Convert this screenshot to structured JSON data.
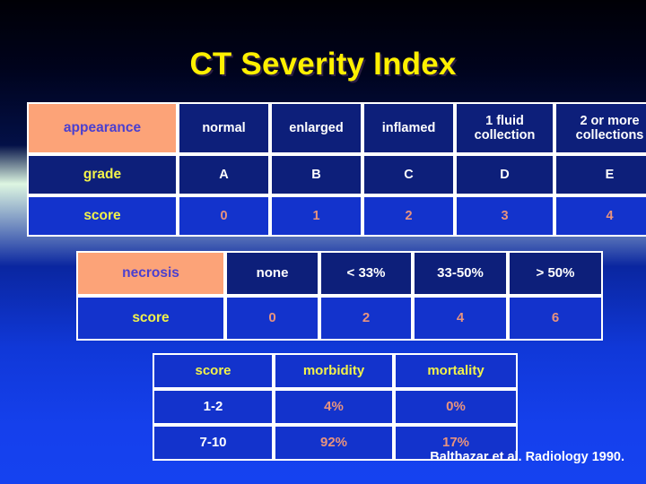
{
  "slide": {
    "title": "CT Severity Index",
    "footer": "Balthazar et al. Radiology 1990.",
    "colors": {
      "title_text": "#FFF000",
      "cell_navy": "#0D1F7A",
      "cell_blue": "#1333CC",
      "cell_peach": "#FCA378",
      "text_white": "#FFFFFF",
      "text_yellow": "#F2F24A",
      "text_purple": "#4A3FD0",
      "text_salmon": "#E8937E",
      "background_top": "#000006",
      "background_bottom": "#1542F0"
    }
  },
  "table_appearance": {
    "rows": [
      {
        "label": "appearance",
        "cells": [
          "normal",
          "enlarged",
          "inflamed",
          "1 fluid\ncollection",
          "2 or more\ncollections"
        ]
      },
      {
        "label": "grade",
        "cells": [
          "A",
          "B",
          "C",
          "D",
          "E"
        ]
      },
      {
        "label": "score",
        "cells": [
          "0",
          "1",
          "2",
          "3",
          "4"
        ]
      }
    ]
  },
  "table_necrosis": {
    "rows": [
      {
        "label": "necrosis",
        "cells": [
          "none",
          "< 33%",
          "33-50%",
          "> 50%"
        ]
      },
      {
        "label": "score",
        "cells": [
          "0",
          "2",
          "4",
          "6"
        ]
      }
    ]
  },
  "table_outcome": {
    "headers": [
      "score",
      "morbidity",
      "mortality"
    ],
    "rows": [
      [
        "1-2",
        "4%",
        "0%"
      ],
      [
        "7-10",
        "92%",
        "17%"
      ]
    ]
  }
}
